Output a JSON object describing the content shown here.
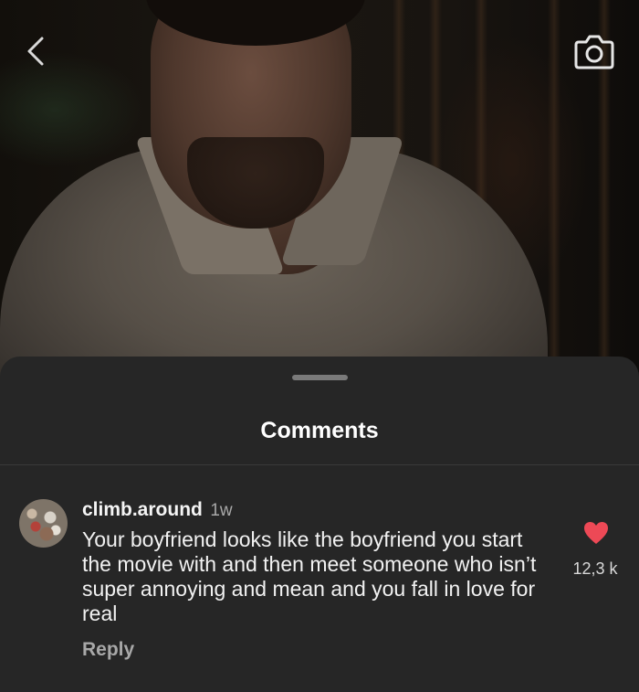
{
  "icons": {
    "back": "chevron-left-icon",
    "camera": "camera-icon",
    "like": "heart-icon"
  },
  "colors": {
    "sheet_background": "#262626",
    "like_heart": "#ed4956",
    "secondary_text": "#a8a8a8"
  },
  "sheet": {
    "title": "Comments"
  },
  "comment": {
    "username": "climb.around",
    "timestamp": "1w",
    "text": "Your boyfriend looks like the boyfriend you start the movie with and then meet someone who isn’t super annoying and mean and you fall in love for real",
    "reply_label": "Reply",
    "like_count": "12,3 k",
    "liked": true
  }
}
